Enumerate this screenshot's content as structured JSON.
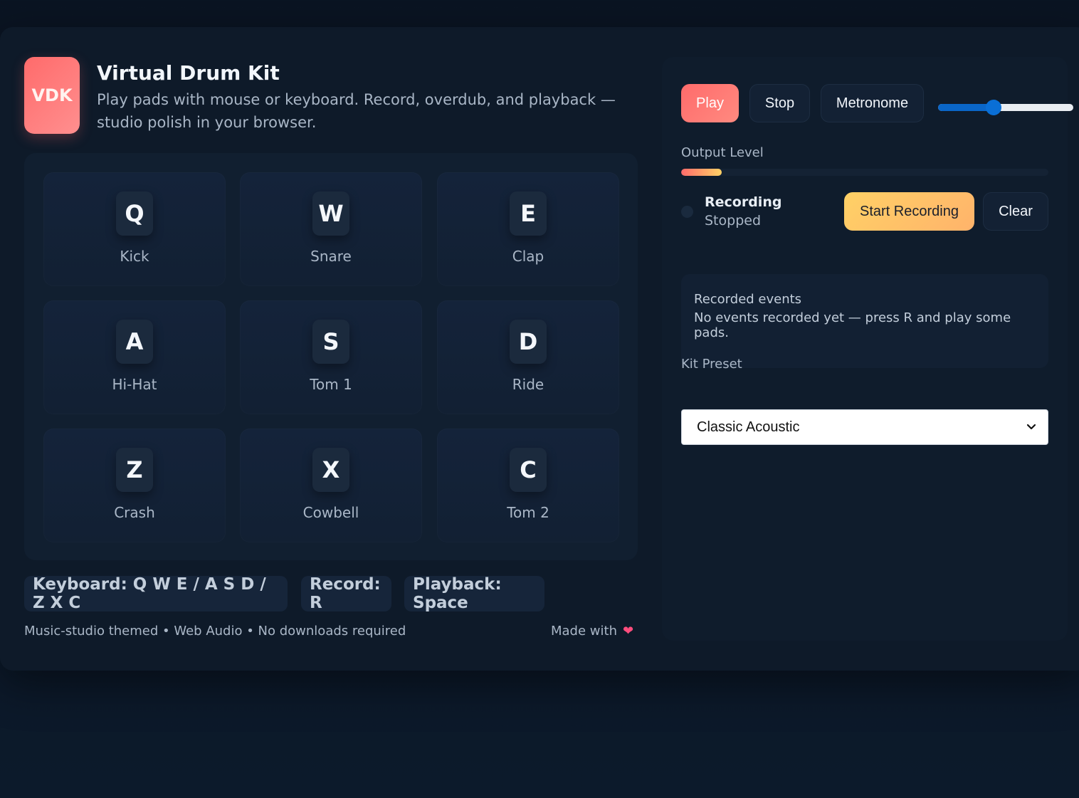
{
  "header": {
    "logo_text": "VDK",
    "title": "Virtual Drum Kit",
    "subtitle": "Play pads with mouse or keyboard. Record, overdub, and playback — studio polish in your browser."
  },
  "pads": [
    {
      "key": "Q",
      "label": "Kick"
    },
    {
      "key": "W",
      "label": "Snare"
    },
    {
      "key": "E",
      "label": "Clap"
    },
    {
      "key": "A",
      "label": "Hi-Hat"
    },
    {
      "key": "S",
      "label": "Tom 1"
    },
    {
      "key": "D",
      "label": "Ride"
    },
    {
      "key": "Z",
      "label": "Crash"
    },
    {
      "key": "X",
      "label": "Cowbell"
    },
    {
      "key": "C",
      "label": "Tom 2"
    }
  ],
  "hints": {
    "keyboard": "Keyboard: Q W E / A S D / Z X C",
    "record": "Record: R",
    "playback": "Playback: Space"
  },
  "footer": {
    "left": "Music-studio themed • Web Audio • No downloads required",
    "right": "Made with",
    "heart_icon": "heart-icon"
  },
  "controls": {
    "play_label": "Play",
    "stop_label": "Stop",
    "metronome_label": "Metronome",
    "volume_fraction": 0.41
  },
  "output": {
    "label": "Output Level",
    "level_fraction": 0.11
  },
  "recording": {
    "title": "Recording",
    "status": "Stopped",
    "start_label": "Start Recording",
    "clear_label": "Clear"
  },
  "events": {
    "title": "Recorded events",
    "empty_message": "No events recorded yet — press R and play some pads."
  },
  "preset": {
    "label": "Kit Preset",
    "selected": "Classic Acoustic"
  },
  "colors": {
    "accent_red": "#ff6b6b",
    "accent_yellow": "#ffd166",
    "slider_blue": "#0a66c8"
  }
}
